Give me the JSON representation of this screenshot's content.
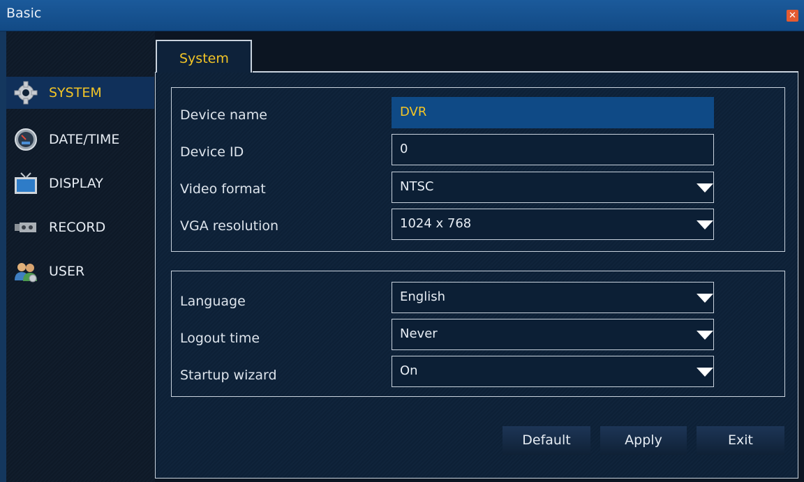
{
  "window": {
    "title": "Basic"
  },
  "sidebar": {
    "items": [
      {
        "label": "SYSTEM",
        "icon": "gear-icon",
        "active": true
      },
      {
        "label": "DATE/TIME",
        "icon": "clock-icon",
        "active": false
      },
      {
        "label": "DISPLAY",
        "icon": "tv-icon",
        "active": false
      },
      {
        "label": "RECORD",
        "icon": "camera-icon",
        "active": false
      },
      {
        "label": "USER",
        "icon": "users-icon",
        "active": false
      }
    ]
  },
  "tab": {
    "label": "System"
  },
  "system": {
    "device_name": {
      "label": "Device name",
      "value": "DVR"
    },
    "device_id": {
      "label": "Device ID",
      "value": "0"
    },
    "video_format": {
      "label": "Video format",
      "value": "NTSC"
    },
    "vga_resolution": {
      "label": "VGA resolution",
      "value": "1024 x 768"
    },
    "language": {
      "label": "Language",
      "value": "English"
    },
    "logout_time": {
      "label": "Logout time",
      "value": "Never"
    },
    "startup_wizard": {
      "label": "Startup wizard",
      "value": "On"
    }
  },
  "buttons": {
    "default": "Default",
    "apply": "Apply",
    "exit": "Exit"
  },
  "colors": {
    "accent": "#f3c526",
    "titlebar": "#1b5a9b",
    "close": "#e45b31"
  }
}
